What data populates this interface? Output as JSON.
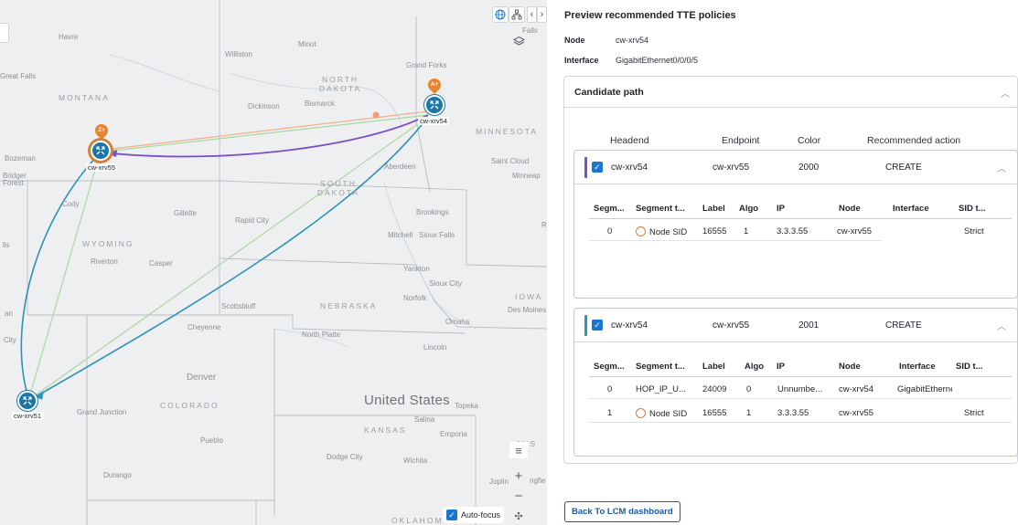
{
  "map": {
    "nodes": [
      {
        "id": "cw-xrv54",
        "label": "cw-xrv54",
        "pin": "A+"
      },
      {
        "id": "cw-xrv55",
        "label": "cw-xrv55",
        "pin": "Z+"
      },
      {
        "id": "cw-xrv51",
        "label": "cw-xrv51"
      }
    ],
    "state_labels": [
      "MONTANA",
      "NORTH DAKOTA",
      "SOUTH DAKOTA",
      "WYOMING",
      "NEBRASKA",
      "COLORADO",
      "KANSAS",
      "MINNESOTA",
      "IOWA",
      "OKLAHOMA"
    ],
    "country_label": "United States",
    "city_labels": [
      "Havre",
      "Williston",
      "Minot",
      "Grand Forks",
      "Great Falls",
      "Dickinson",
      "Bismarck",
      "Bozeman",
      "Aberdeen",
      "Saint Cloud",
      "Minneap",
      "Cody",
      "Gillette",
      "Rapid City",
      "Brookings",
      "Mitchell",
      "Sioux Falls",
      "Riverton",
      "Casper",
      "Yankton",
      "Sioux City",
      "Norfolk",
      "Scottsbluff",
      "Omaha",
      "Des Moines",
      "Cheyenne",
      "North Platte",
      "Lincoln",
      "Denver",
      "Grand Junction",
      "Topeka",
      "Salina",
      "Emporia",
      "Pueblo",
      "Dodge City",
      "Wichita",
      "Durango",
      "Joplin",
      "Falls",
      "lls",
      "an",
      "City",
      "Bridger Forest",
      "MIS",
      "ngfie",
      "R"
    ],
    "autofocus_label": "Auto-focus",
    "autofocus_checked": true,
    "colors": {
      "purple_path": "#7b4fc7",
      "teal_path": "#2b93b5",
      "light_green": "#a9d7a0",
      "orange": "#f2a882",
      "node": "#1b76a8"
    }
  },
  "panel": {
    "title": "Preview recommended TTE policies",
    "node_key": "Node",
    "node_value": "cw-xrv54",
    "interface_key": "Interface",
    "interface_value": "GigabitEthernet0/0/0/5",
    "candidate_title": "Candidate path",
    "columns": {
      "headend": "Headend",
      "endpoint": "Endpoint",
      "color": "Color",
      "action": "Recommended action"
    },
    "paths": [
      {
        "accent": "#7b4fc7",
        "headend": "cw-xrv54",
        "endpoint": "cw-xrv55",
        "color": "2000",
        "action": "CREATE",
        "sub_headers": [
          "Segm...",
          "Segment t...",
          "Label",
          "Algo",
          "IP",
          "Node",
          "Interface",
          "SID t..."
        ],
        "rows": [
          {
            "seg": "0",
            "type": "Node SID",
            "label": "16555",
            "algo": "1",
            "ip": "3.3.3.55",
            "node": "cw-xrv55",
            "iface": "",
            "sid": "Strict"
          }
        ]
      },
      {
        "accent": "#2b93b5",
        "headend": "cw-xrv54",
        "endpoint": "cw-xrv55",
        "color": "2001",
        "action": "CREATE",
        "sub_headers": [
          "Segm...",
          "Segment t...",
          "Label",
          "Algo",
          "IP",
          "Node",
          "Interface",
          "SID t..."
        ],
        "rows": [
          {
            "seg": "0",
            "type": "HOP_IP_U...",
            "label": "24009",
            "algo": "0",
            "ip": "Unnumbe...",
            "node": "cw-xrv54",
            "iface": "GigabitEtherne",
            "sid": ""
          },
          {
            "seg": "1",
            "type": "Node SID",
            "label": "16555",
            "algo": "1",
            "ip": "3.3.3.55",
            "node": "cw-xrv55",
            "iface": "",
            "sid": "Strict"
          }
        ]
      }
    ],
    "back_button": "Back To LCM dashboard"
  }
}
